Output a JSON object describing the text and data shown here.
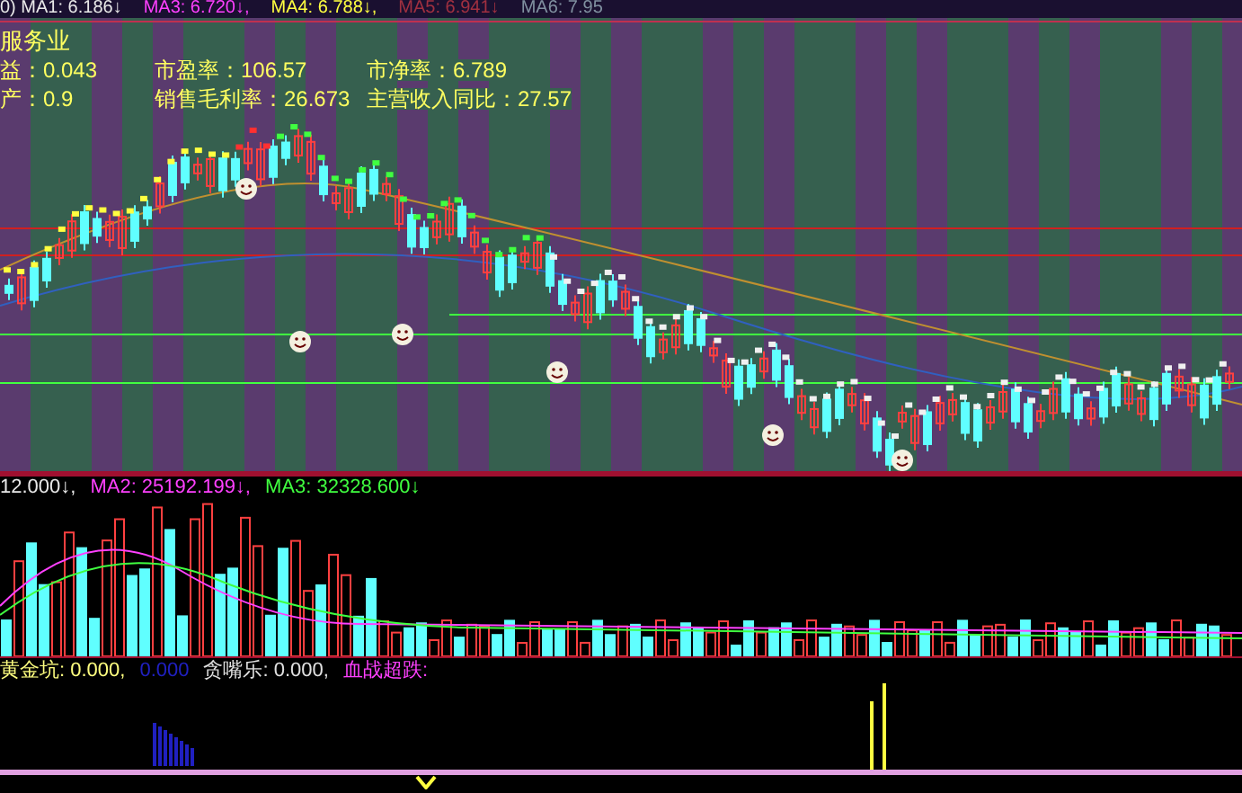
{
  "price_panel": {
    "ma_legend": [
      {
        "label": "0) MA1: 6.186↓",
        "color": "#e8e8e8"
      },
      {
        "label": "MA3: 6.720↓,",
        "color": "#ff40ff"
      },
      {
        "label": "MA4: 6.788↓,",
        "color": "#ffff40"
      },
      {
        "label": "MA5: 6.941↓",
        "color": "#a03040"
      },
      {
        "label": "MA6: 7.95",
        "color": "#8090a0"
      }
    ],
    "sector": "服务业",
    "info_rows": [
      [
        "益：0.043",
        "市盈率：106.57",
        "市净率：6.789"
      ],
      [
        "产：0.9",
        "销售毛利率：26.673",
        "主营收入同比：27.57"
      ]
    ]
  },
  "volume_panel": {
    "legend": [
      {
        "label": "12.000↓,",
        "color": "#e8e8e8"
      },
      {
        "label": "MA2: 25192.199↓,",
        "color": "#ff40ff"
      },
      {
        "label": "MA3: 32328.600↓",
        "color": "#40ff40"
      }
    ]
  },
  "indicator_panel": {
    "legend": [
      {
        "label": "黄金坑: 0.000,",
        "color": "#ffff80"
      },
      {
        "label": "0.000",
        "color": "#2020c0"
      },
      {
        "label": "贪嘴乐: 0.000,",
        "color": "#e0e0e0"
      },
      {
        "label": "血战超跌:",
        "color": "#ff40ff"
      }
    ]
  }
}
